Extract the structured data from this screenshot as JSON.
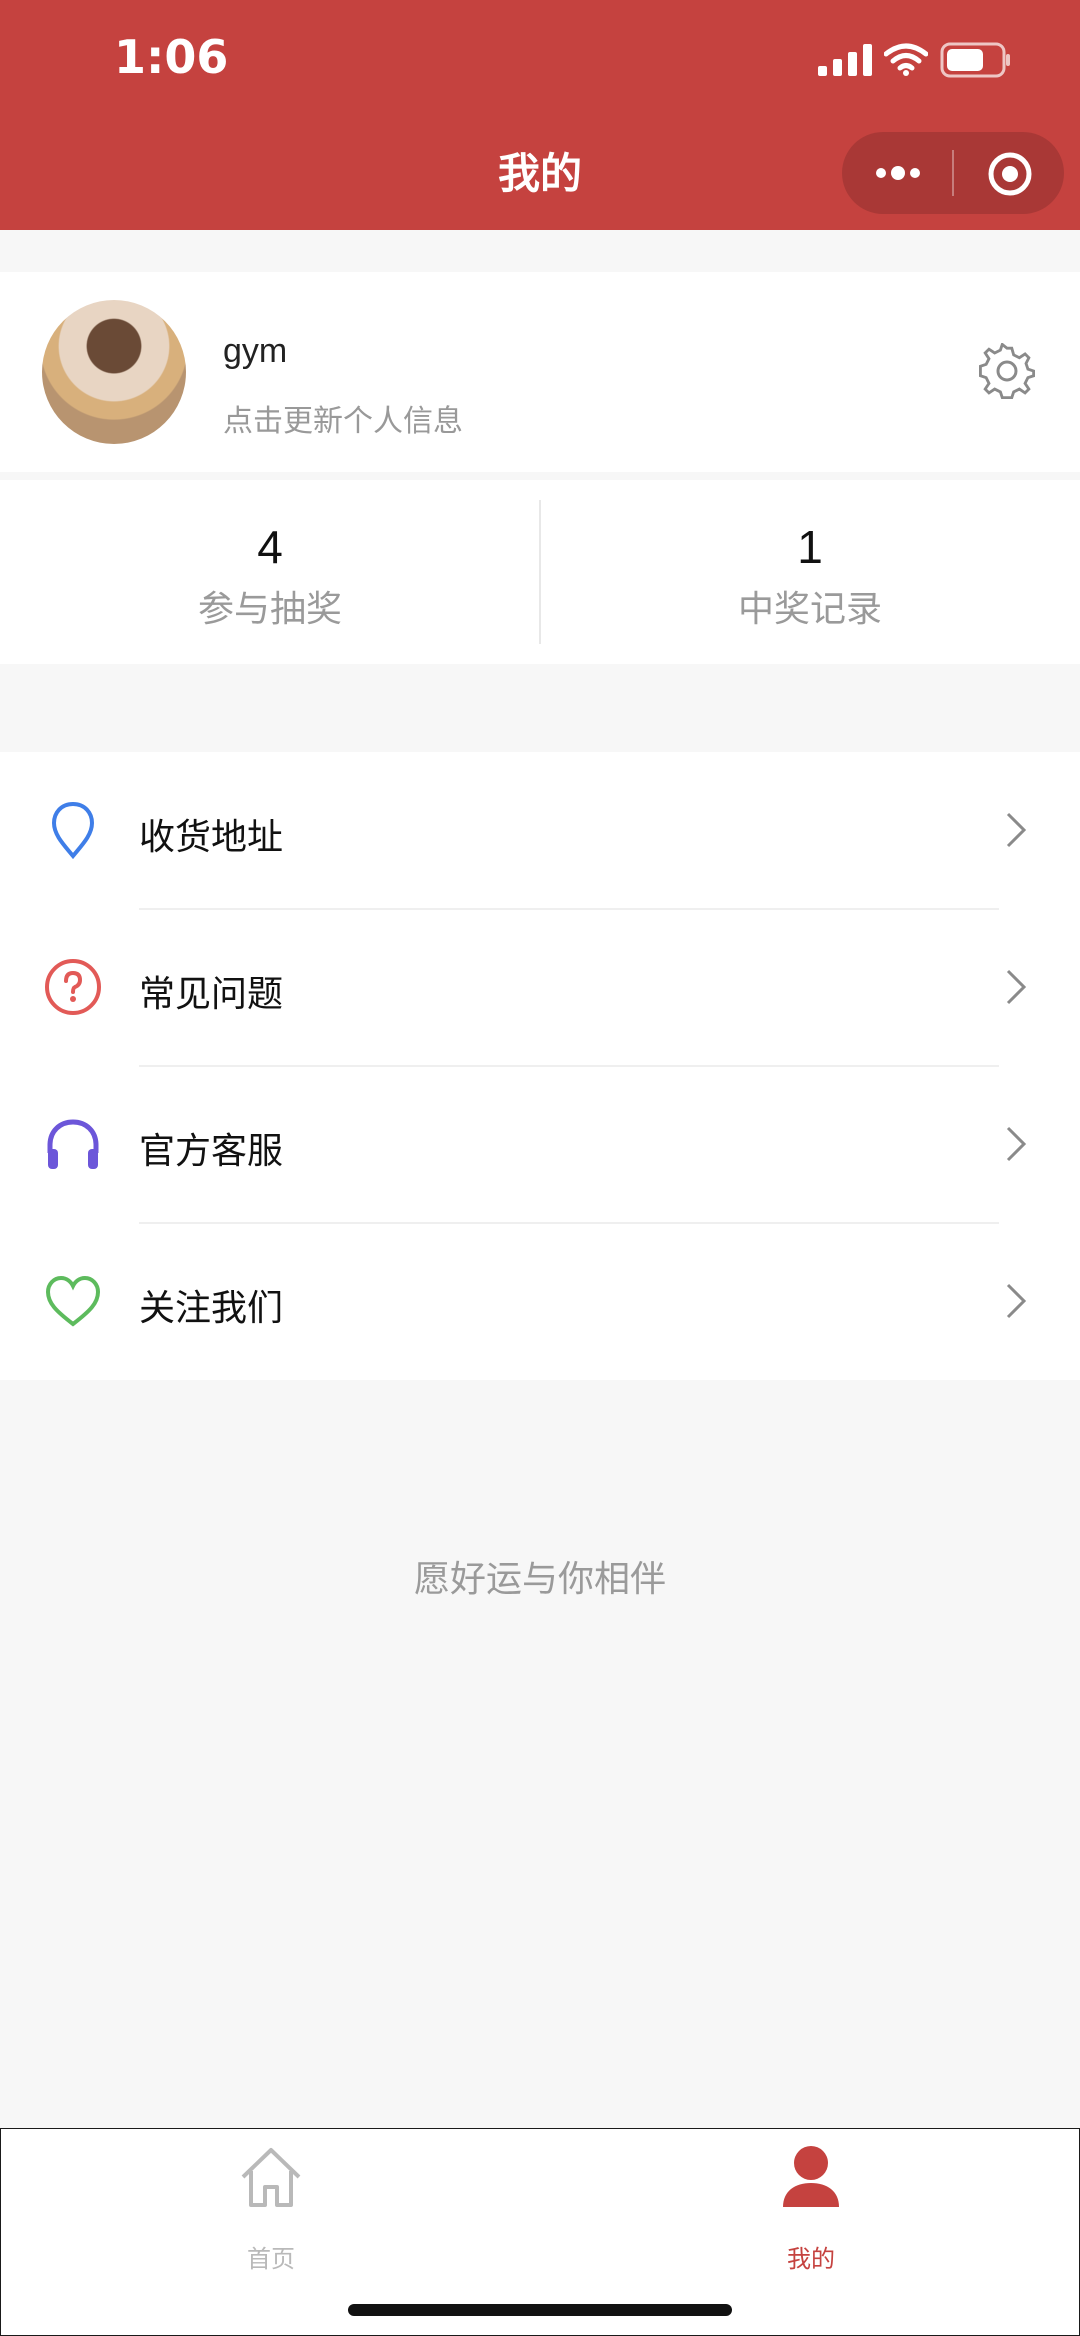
{
  "status": {
    "time": "1:06"
  },
  "header": {
    "title": "我的",
    "capsule": {
      "more_icon": "more-dots-icon",
      "close_icon": "target-circle-icon"
    }
  },
  "profile": {
    "name": "gym",
    "hint": "点击更新个人信息",
    "settings_icon": "gear-icon"
  },
  "stats": {
    "participated_count": "4",
    "participated_label": "参与抽奖",
    "won_count": "1",
    "won_label": "中奖记录"
  },
  "menu": {
    "items": [
      {
        "label": "收货地址",
        "icon": "location-pin-icon",
        "color": "#3f7ee8"
      },
      {
        "label": "常见问题",
        "icon": "question-circle-icon",
        "color": "#e25a57"
      },
      {
        "label": "官方客服",
        "icon": "headset-icon",
        "color": "#6c56d9"
      },
      {
        "label": "关注我们",
        "icon": "heart-icon",
        "color": "#5dbb5d"
      }
    ]
  },
  "motto": "愿好运与你相伴",
  "tabbar": {
    "tabs": [
      {
        "label": "首页",
        "icon": "home-icon",
        "active": false,
        "color": "#b9b9b9"
      },
      {
        "label": "我的",
        "icon": "user-icon",
        "active": true,
        "color": "#c5423f"
      }
    ]
  },
  "colors": {
    "brand": "#c5423f",
    "background": "#f7f7f7"
  }
}
